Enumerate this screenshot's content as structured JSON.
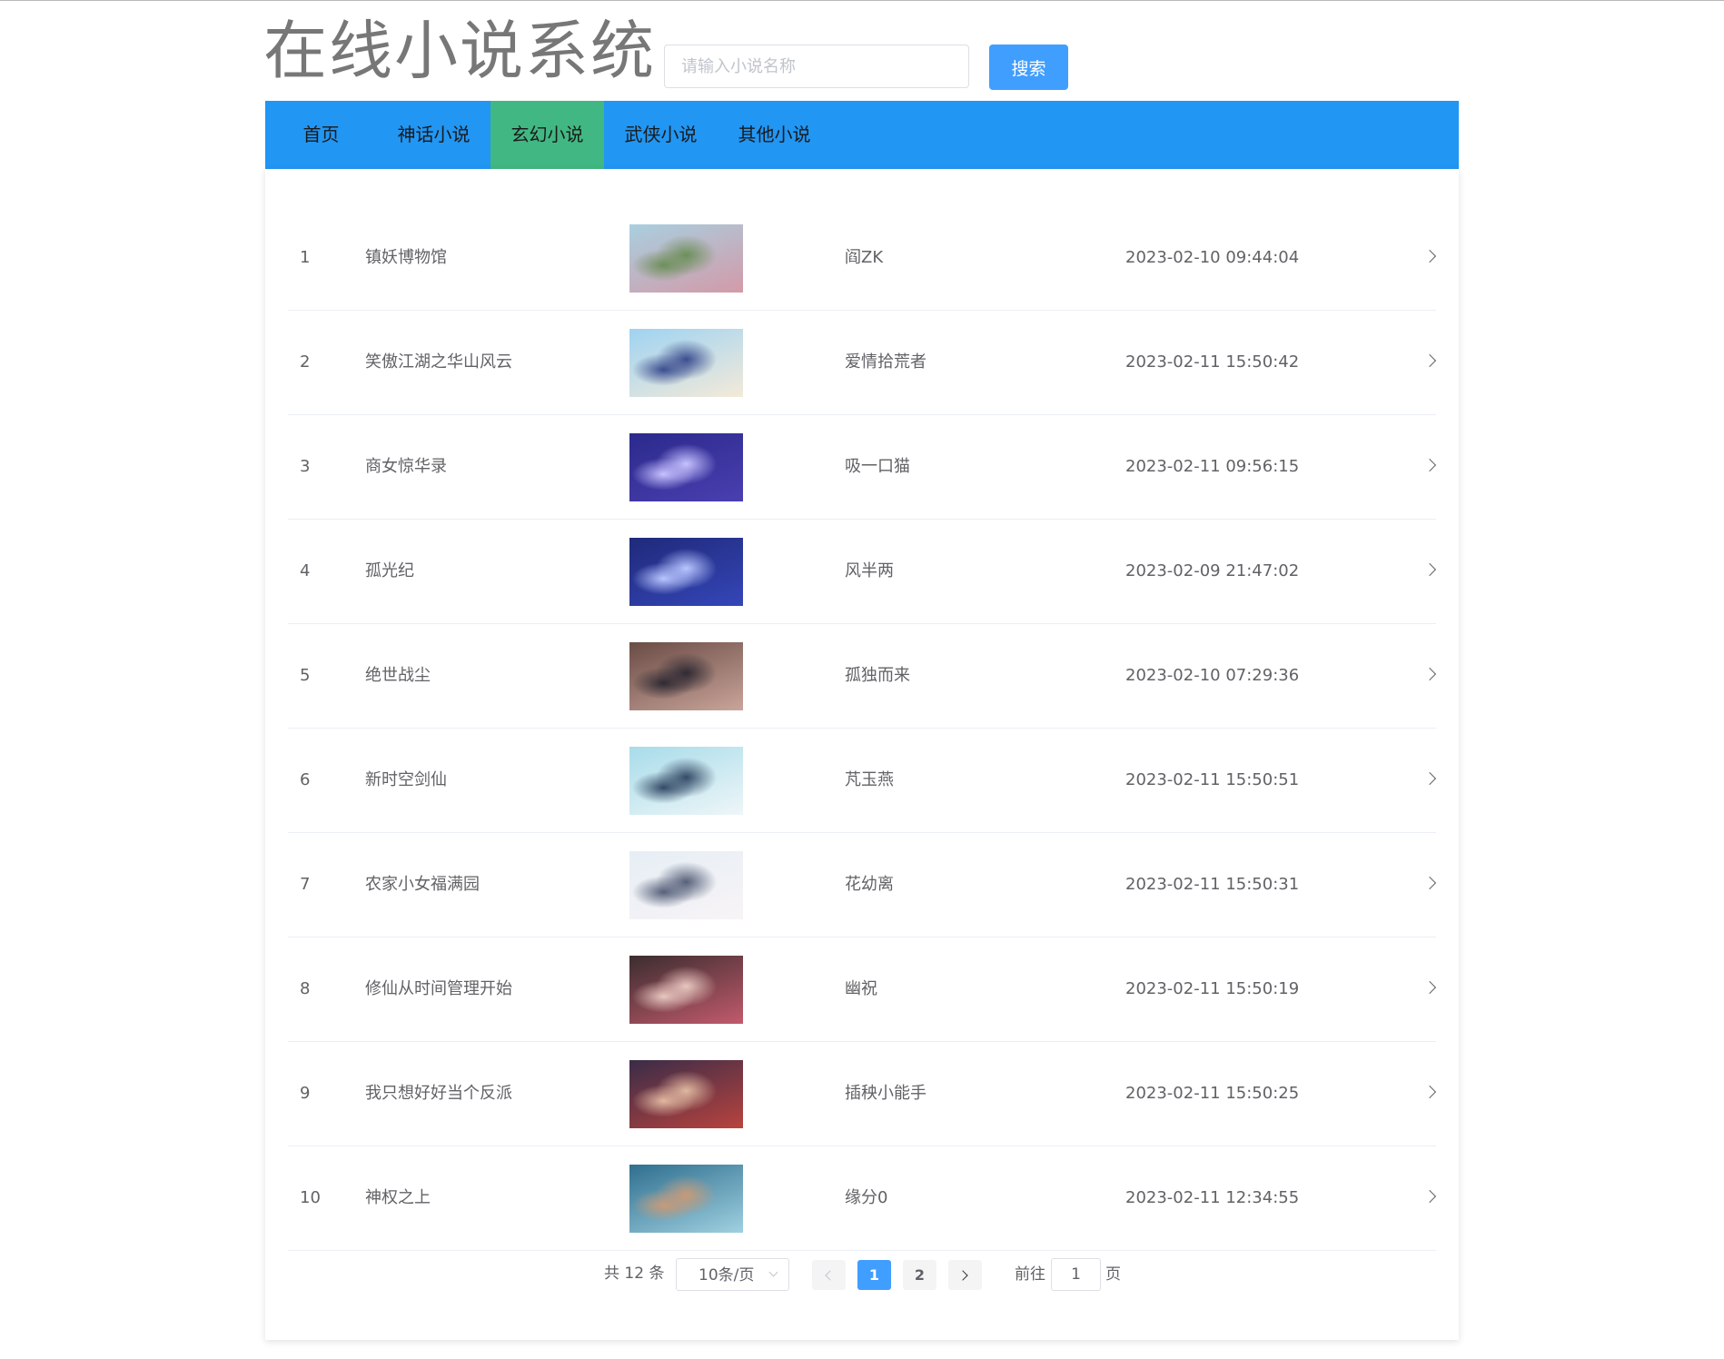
{
  "header": {
    "title": "在线小说系统",
    "search_placeholder": "请输入小说名称",
    "search_value": "",
    "search_button": "搜索"
  },
  "nav": {
    "items": [
      {
        "label": "首页",
        "active": false
      },
      {
        "label": "神话小说",
        "active": false
      },
      {
        "label": "玄幻小说",
        "active": true
      },
      {
        "label": "武侠小说",
        "active": false
      },
      {
        "label": "其他小说",
        "active": false
      }
    ]
  },
  "colors": {
    "nav_background": "#2196f3",
    "nav_active": "#41b883",
    "primary_button": "#409eff"
  },
  "novels": [
    {
      "index": "1",
      "title": "镇妖博物馆",
      "author": "阎ZK",
      "date": "2023-02-10 09:44:04",
      "cover": {
        "top": "#a9cfe0",
        "bottom": "#d39aa8",
        "accent": "#6d8f5a"
      }
    },
    {
      "index": "2",
      "title": "笑傲江湖之华山风云",
      "author": "爱情拾荒者",
      "date": "2023-02-11 15:50:42",
      "cover": {
        "top": "#9fd3f2",
        "bottom": "#f4ead9",
        "accent": "#3b4d8f"
      }
    },
    {
      "index": "3",
      "title": "商女惊华录",
      "author": "吸一口猫",
      "date": "2023-02-11 09:56:15",
      "cover": {
        "top": "#2b2a8c",
        "bottom": "#4a3fb0",
        "accent": "#c7c2ff"
      }
    },
    {
      "index": "4",
      "title": "孤光纪",
      "author": "风半两",
      "date": "2023-02-09 21:47:02",
      "cover": {
        "top": "#1f2a7a",
        "bottom": "#3546b8",
        "accent": "#b9c6ff"
      }
    },
    {
      "index": "5",
      "title": "绝世战尘",
      "author": "孤独而来",
      "date": "2023-02-10 07:29:36",
      "cover": {
        "top": "#6a4c45",
        "bottom": "#c9a49a",
        "accent": "#2f2a33"
      }
    },
    {
      "index": "6",
      "title": "新时空剑仙",
      "author": "芃玉燕",
      "date": "2023-02-11 15:50:51",
      "cover": {
        "top": "#a8dcea",
        "bottom": "#eef6f8",
        "accent": "#334a66"
      }
    },
    {
      "index": "7",
      "title": "农家小女福满园",
      "author": "花幼离",
      "date": "2023-02-11 15:50:31",
      "cover": {
        "top": "#e6eef5",
        "bottom": "#f8f4f6",
        "accent": "#56607a"
      }
    },
    {
      "index": "8",
      "title": "修仙从时间管理开始",
      "author": "幽祝",
      "date": "2023-02-11 15:50:19",
      "cover": {
        "top": "#3b2d2f",
        "bottom": "#c25a6c",
        "accent": "#e8c7c0"
      }
    },
    {
      "index": "9",
      "title": "我只想好好当个反派",
      "author": "插秧小能手",
      "date": "2023-02-11 15:50:25",
      "cover": {
        "top": "#3a2c48",
        "bottom": "#b8433e",
        "accent": "#e0b8a0"
      }
    },
    {
      "index": "10",
      "title": "神权之上",
      "author": "缘分0",
      "date": "2023-02-11 12:34:55",
      "cover": {
        "top": "#2f6f8f",
        "bottom": "#9fd0e0",
        "accent": "#c89a78"
      }
    }
  ],
  "pagination": {
    "total_text": "共 12 条",
    "page_size": "10条/页",
    "pages": [
      "1",
      "2"
    ],
    "current_page": "1",
    "goto_label": "前往",
    "goto_value": "1",
    "page_suffix": "页"
  }
}
